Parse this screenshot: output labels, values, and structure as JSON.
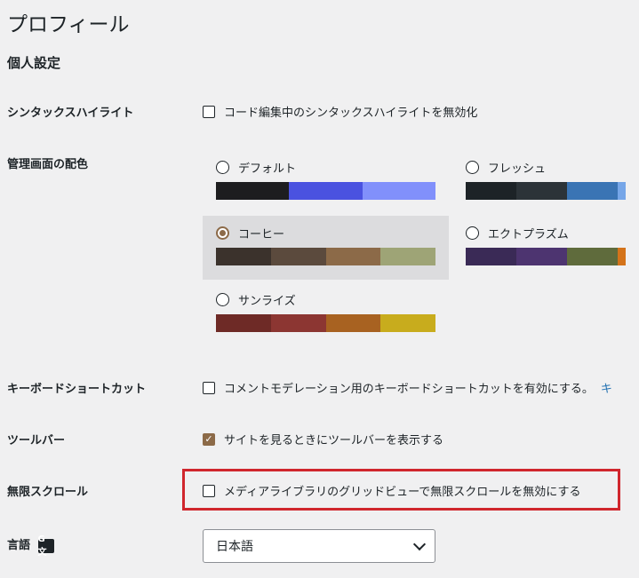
{
  "page": {
    "title": "プロフィール",
    "section_title": "個人設定"
  },
  "syntax": {
    "label": "シンタックスハイライト",
    "checkbox_label": "コード編集中のシンタックスハイライトを無効化",
    "checked": false
  },
  "color_scheme": {
    "label": "管理画面の配色",
    "schemes": [
      {
        "name": "デフォルト",
        "selected": false,
        "colors": [
          "#1d2327",
          "#2c3338",
          "#2271b1",
          "#72aee6"
        ]
      },
      {
        "name": "フレッシュ",
        "selected": false,
        "colors": [
          "#1d2327",
          "#2c3338",
          "#2271b1",
          "#72aee6"
        ]
      },
      {
        "name": "コーヒー",
        "selected": true,
        "colors": [
          "#46403c",
          "#59524c",
          "#c7a589",
          "#9ea476"
        ]
      },
      {
        "name": "エクトプラズム",
        "selected": false,
        "colors": [
          "#413256",
          "#523f6d",
          "#a3b745",
          "#d46f15"
        ]
      },
      {
        "name": "サンライズ",
        "selected": false,
        "colors": [
          "#b43c38",
          "#cf4944",
          "#dd823b",
          "#ccaf0b"
        ]
      }
    ],
    "display_colors": {
      "default": [
        "#1d1d1f",
        "#4a52e0",
        "#8190fb",
        "#ffffff"
      ],
      "fresh": [
        "#1d2327",
        "#2c3338",
        "#3a74b4",
        "#76a6e8"
      ],
      "coffee": [
        "#3b322c",
        "#5b4a3d",
        "#8c6a48",
        "#9ea476"
      ],
      "ectoplasm": [
        "#3a2a56",
        "#4d3470",
        "#5f6b3c",
        "#d4731a"
      ],
      "sunrise": [
        "#6e2a26",
        "#8c3632",
        "#a86221",
        "#c8ac1d"
      ]
    }
  },
  "keyboard": {
    "label": "キーボードショートカット",
    "checkbox_label": "コメントモデレーション用のキーボードショートカットを有効にする。",
    "link_text": "キ",
    "checked": false
  },
  "toolbar": {
    "label": "ツールバー",
    "checkbox_label": "サイトを見るときにツールバーを表示する",
    "checked": true
  },
  "infinite_scroll": {
    "label": "無限スクロール",
    "checkbox_label": "メディアライブラリのグリッドビューで無限スクロールを無効にする",
    "checked": false
  },
  "language": {
    "label": "言語",
    "selected": "日本語"
  },
  "colors": {
    "accent": "#8c6a48",
    "highlight_border": "#d0262d",
    "link": "#2271b1"
  }
}
